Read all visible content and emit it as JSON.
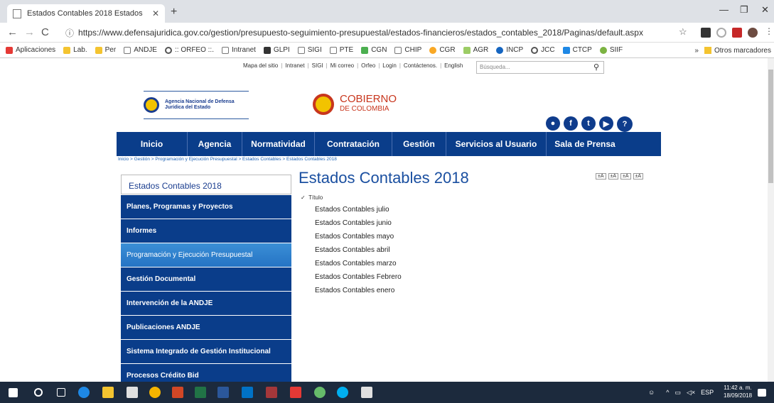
{
  "browser": {
    "tab_title": "Estados Contables 2018 Estados",
    "url": "https://www.defensajuridica.gov.co/gestion/presupuesto-seguimiento-presupuestal/estados-financieros/estados_contables_2018/Paginas/default.aspx",
    "bookmarks": [
      "Aplicaciones",
      "Lab.",
      "Per",
      "ANDJE",
      ":: ORFEO ::.",
      "Intranet",
      "GLPI",
      "SIGI",
      "PTE",
      "CGN",
      "CHIP",
      "CGR",
      "AGR",
      "INCP",
      "JCC",
      "CTCP",
      "SIIF"
    ],
    "other_bookmarks": "Otros marcadores"
  },
  "site": {
    "util_links": [
      "Mapa del sitio",
      "Intranet",
      "SIGI",
      "Mi correo",
      "Orfeo",
      "Login",
      "Contáctenos.",
      "English"
    ],
    "search_placeholder": "Búsqueda...",
    "agency_line1": "Agencia Nacional de Defensa",
    "agency_line2": "Jurídica del Estado",
    "gob_line1": "COBIERNO",
    "gob_line2": "DE COLOMBIA",
    "nav": [
      "Inicio",
      "Agencia",
      "Normatividad",
      "Contratación",
      "Gestión",
      "Servicios al Usuario",
      "Sala de Prensa"
    ],
    "breadcrumb": "Inicio > Gestión > Programación y Ejecución Presupuestal > Estados Contables > Estados Contables 2018",
    "sidebar_title": "Estados Contables 2018",
    "sidebar_items": [
      "Planes, Programas y Proyectos",
      "Informes",
      "Programación y Ejecución Presupuestal",
      "Gestión Documental",
      "Intervención de la ANDJE",
      "Publicaciones ANDJE",
      "Sistema Integrado de Gestión Institucional",
      "Procesos Crédito Bid"
    ],
    "page_title": "Estados Contables 2018",
    "sort_label": "Título",
    "documents": [
      "Estados Contables julio",
      "Estados Contables junio",
      "Estados Contables mayo",
      "Estados Contables abril",
      "Estados Contables marzo",
      "Estados Contables Febrero",
      "Estados Contables enero"
    ],
    "font_controls": [
      "±A",
      "±A",
      "±A",
      "±A"
    ]
  },
  "taskbar": {
    "lang": "ESP",
    "time": "11:42 a. m.",
    "date": "18/09/2018"
  }
}
